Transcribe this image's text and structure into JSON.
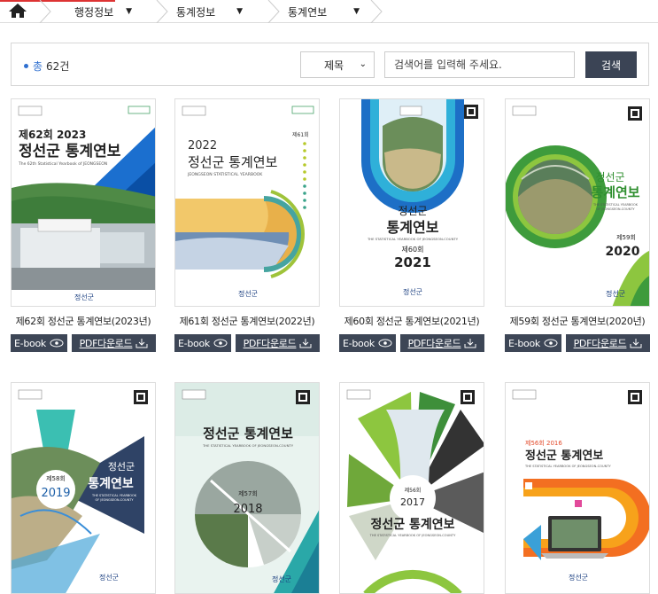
{
  "breadcrumb": {
    "home_icon": "home-icon",
    "items": [
      {
        "label": "행정정보"
      },
      {
        "label": "통계정보"
      },
      {
        "label": "통계연보"
      }
    ]
  },
  "search": {
    "count_label": "총",
    "count_value": "62건",
    "field_selected": "제목",
    "placeholder": "검색어를 입력해 주세요.",
    "button_label": "검색"
  },
  "buttons": {
    "ebook": "E-book",
    "pdf": "PDF다운로드"
  },
  "colors": {
    "accent_blue": "#2e6fd0",
    "button_dark": "#3d4656"
  },
  "books": [
    {
      "title": "제62회 정선군 통계연보(2023년)",
      "cover": {
        "edition": "제62회 2023",
        "name": "정선군 통계연보",
        "sub": "The 62th Statistical Yearbook of JEONGSEON",
        "logo": "정선군"
      }
    },
    {
      "title": "제61회 정선군 통계연보(2022년)",
      "cover": {
        "year": "2022",
        "name": "정선군 통계연보",
        "sub": "JEONGSEON STATISTICAL YEARBOOK",
        "edition": "제61회",
        "logo": "정선군"
      }
    },
    {
      "title": "제60회 정선군 통계연보(2021년)",
      "cover": {
        "name1": "정선군",
        "name2": "통계연보",
        "sub": "THE STATISTICAL YEARBOOK OF JEONGSEON-COUNTY",
        "edition": "제60회",
        "year": "2021",
        "logo": "정선군"
      }
    },
    {
      "title": "제59회 정선군 통계연보(2020년)",
      "cover": {
        "name1": "정선군",
        "name2": "통계연보",
        "sub1": "THE STATISTICAL YEARBOOK",
        "sub2": "OF JEONGSEON-COUNTY",
        "edition": "제59회",
        "year": "2020",
        "logo": "정선군"
      }
    },
    {
      "cover": {
        "name1": "정선군",
        "name2": "통계연보",
        "sub1": "THE STATISTICAL YEARBOOK",
        "sub2": "OF JEONGSEON-COUNTY",
        "edition": "제58회",
        "year": "2019",
        "logo": "정선군"
      }
    },
    {
      "cover": {
        "name": "정선군 통계연보",
        "sub": "THE STATISTICAL YEARBOOK OF JEONGSEON-COUNTY",
        "edition": "제57회",
        "year": "2018",
        "logo": "정선군"
      }
    },
    {
      "cover": {
        "edition": "제56회",
        "year": "2017",
        "name": "정선군 통계연보",
        "sub": "THE STATISTICAL YEARBOOK OF JEONGSEON-COUNTY"
      }
    },
    {
      "cover": {
        "edition": "제56회 2016",
        "name": "정선군 통계연보",
        "sub": "THE STATISTICAL YEARBOOK OF JEONGSEON-COUNTY",
        "logo": "정선군"
      }
    }
  ]
}
